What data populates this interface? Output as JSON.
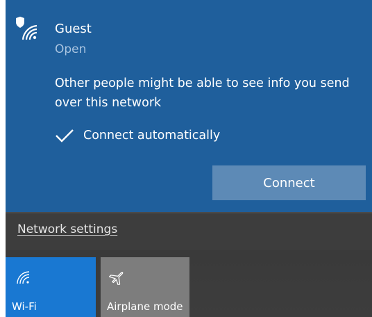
{
  "network": {
    "name": "Guest",
    "status": "Open",
    "warning": "Other people might be able to see info you send over this network",
    "icon": "wifi-shield-icon",
    "connect_automatically": {
      "label": "Connect automatically",
      "checked": true
    },
    "connect_label": "Connect"
  },
  "settings": {
    "link_label": "Network settings"
  },
  "quick_actions": [
    {
      "label": "Wi-Fi",
      "icon": "wifi-icon",
      "active": true
    },
    {
      "label": "Airplane mode",
      "icon": "airplane-icon",
      "active": false
    }
  ],
  "colors": {
    "panel": "#1f5f9c",
    "accent_tile": "#1978d2",
    "button": "#5d8ab6",
    "dark": "#3d3d3d"
  }
}
